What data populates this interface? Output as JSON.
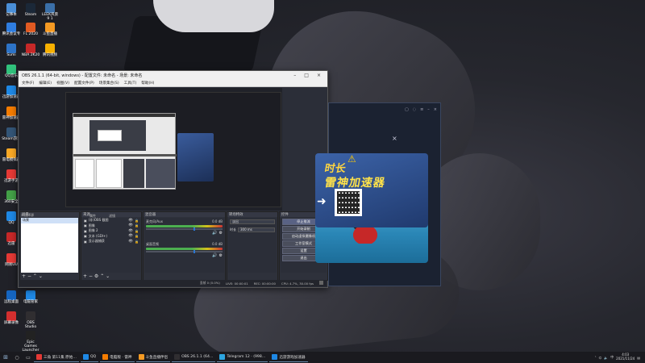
{
  "desktop_icons": [
    {
      "label": "记事本",
      "color": "#4a8fd8"
    },
    {
      "label": "Steam",
      "color": "#1b2838"
    },
    {
      "label": "LEEK风景 9 1",
      "color": "#3a6fa8"
    },
    {
      "label": "腾讯会议专",
      "color": "#2f7de0"
    },
    {
      "label": "FL 2020",
      "color": "#e15a22"
    },
    {
      "label": "斗鱼直播",
      "color": "#f59a23"
    },
    {
      "label": "Sumi",
      "color": "#2d73c7"
    },
    {
      "label": "NBA 2K20",
      "color": "#c62828"
    },
    {
      "label": "腾讯视频",
      "color": "#f7b000"
    },
    {
      "label": "QQ音乐",
      "color": "#31c27c"
    },
    {
      "label": "迅游加速器",
      "color": "#1e88e5"
    },
    {
      "label": "雷神加速器",
      "color": "#f57c00"
    },
    {
      "label": "Steam游戏",
      "color": "#335577"
    },
    {
      "label": "雷电模拟器",
      "color": "#f9a825"
    },
    {
      "label": "迅游手游",
      "color": "#e53935"
    },
    {
      "label": "360安全",
      "color": "#43a047"
    },
    {
      "label": "QQ",
      "color": "#1e88e5"
    },
    {
      "label": "迅雷",
      "color": "#c62828"
    },
    {
      "label": "网易UU",
      "color": "#e53935"
    },
    {
      "label": "远程桌面",
      "color": "#1565c0"
    },
    {
      "label": "电脑管家",
      "color": "#1e88e5"
    },
    {
      "label": "屏幕录像",
      "color": "#d32f2f"
    },
    {
      "label": "OBS Studio",
      "color": "#302e31"
    },
    {
      "label": "Epic Games Launcher",
      "color": "#222"
    }
  ],
  "obs": {
    "title": "OBS 26.1.1 (64-bit, windows) - 配置文件: 未命名 - 场景: 未命名",
    "menu": [
      "文件(F)",
      "编辑(E)",
      "视图(V)",
      "配置文件(P)",
      "场景集合(S)",
      "工具(T)",
      "帮助(H)"
    ],
    "docks": {
      "scenes": {
        "title": "场景",
        "items": [
          "场景"
        ]
      },
      "sources": {
        "title": "来源",
        "items": [
          {
            "label": "(非)OBS 截图"
          },
          {
            "label": "图像"
          },
          {
            "label": "图像 2"
          },
          {
            "label": "文本 (GDI+)"
          },
          {
            "label": "显示器捕获"
          }
        ]
      },
      "mixer": {
        "title": "混音器",
        "channels": [
          {
            "name": "麦克风/Aux",
            "level": "0.0 dB"
          },
          {
            "name": "桌面音频",
            "level": "0.0 dB"
          }
        ]
      },
      "transitions": {
        "title": "转场特效",
        "type": "淡出",
        "duration_label": "时长",
        "duration": "300 ms"
      },
      "controls": {
        "title": "控件",
        "buttons": [
          "停止推流",
          "开始录制",
          "启动虚拟摄像机",
          "工作室模式",
          "设置",
          "退出"
        ]
      },
      "filters_label": "滤镜",
      "properties_label": "属性",
      "no_source": "未选择源"
    },
    "status": {
      "drop": "丢帧 0 (0.0%)",
      "live": "LIVE: 00:00:01",
      "rec": "REC: 00:00:00",
      "cpu": "CPU: 4.7%, 30.00 fps"
    }
  },
  "ad": {
    "close": "×",
    "line1": "时长",
    "line2": "雷神加速器",
    "arrow": "➜"
  },
  "taskbar": {
    "items": [
      {
        "label": "三角 第11集 原始…",
        "color": "#e53935"
      },
      {
        "label": "QQ",
        "color": "#1e88e5"
      },
      {
        "label": "电脑版 · 雷神",
        "color": "#f57c00"
      },
      {
        "label": "斗鱼直播伴侣",
        "color": "#f59a23"
      },
      {
        "label": "OBS 26.1.1 (64…",
        "color": "#302e31"
      },
      {
        "label": "Telegram 12 · (998…",
        "color": "#2ca5e0"
      },
      {
        "label": "迅游游戏加速器",
        "color": "#1e88e5"
      }
    ],
    "time": "4:03",
    "date": "2021/11/24"
  }
}
